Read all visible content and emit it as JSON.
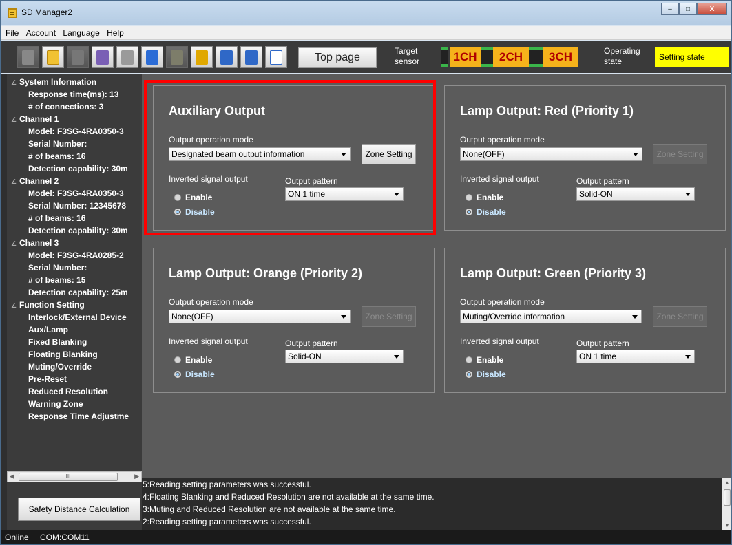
{
  "window": {
    "title": "SD Manager2",
    "minimize": "–",
    "maximize": "□",
    "close": "X"
  },
  "menu": [
    "File",
    "Account",
    "Language",
    "Help"
  ],
  "toolbar": {
    "top_page": "Top page",
    "target_sensor": [
      "Target",
      "sensor"
    ],
    "channels": [
      "1CH",
      "2CH",
      "3CH"
    ],
    "channel_color": "#f5b21b",
    "operating_state_label": [
      "Operating",
      "state"
    ],
    "operating_state": "Setting state",
    "state_color": "#ffff00"
  },
  "tree": [
    {
      "level": 0,
      "text": "System Information"
    },
    {
      "level": 1,
      "text": "Response time(ms): 13"
    },
    {
      "level": 1,
      "text": "# of connections: 3"
    },
    {
      "level": 0,
      "text": "Channel 1"
    },
    {
      "level": 1,
      "text": "Model: F3SG-4RA0350-3"
    },
    {
      "level": 1,
      "text": "Serial Number:"
    },
    {
      "level": 1,
      "text": "# of beams: 16"
    },
    {
      "level": 1,
      "text": "Detection capability: 30m"
    },
    {
      "level": 0,
      "text": "Channel 2"
    },
    {
      "level": 1,
      "text": "Model: F3SG-4RA0350-3"
    },
    {
      "level": 1,
      "text": "Serial Number: 12345678"
    },
    {
      "level": 1,
      "text": "# of beams: 16"
    },
    {
      "level": 1,
      "text": "Detection capability: 30m"
    },
    {
      "level": 0,
      "text": "Channel 3"
    },
    {
      "level": 1,
      "text": "Model: F3SG-4RA0285-2"
    },
    {
      "level": 1,
      "text": "Serial Number:"
    },
    {
      "level": 1,
      "text": "# of beams: 15"
    },
    {
      "level": 1,
      "text": "Detection capability: 25m"
    },
    {
      "level": 0,
      "text": "Function Setting"
    },
    {
      "level": 1,
      "text": "Interlock/External Device"
    },
    {
      "level": 1,
      "text": "Aux/Lamp"
    },
    {
      "level": 1,
      "text": "Fixed Blanking"
    },
    {
      "level": 1,
      "text": "Floating Blanking"
    },
    {
      "level": 1,
      "text": "Muting/Override"
    },
    {
      "level": 1,
      "text": "Pre-Reset"
    },
    {
      "level": 1,
      "text": "Reduced Resolution"
    },
    {
      "level": 1,
      "text": "Warning Zone"
    },
    {
      "level": 1,
      "text": "Response Time Adjustme"
    }
  ],
  "hscroll_thumb": "III",
  "safety_distance_button": "Safety Distance Calculation",
  "labels": {
    "output_operation_mode": "Output operation mode",
    "inverted_signal_output": "Inverted signal output",
    "output_pattern": "Output pattern",
    "enable": "Enable",
    "disable": "Disable",
    "zone_setting": "Zone Setting"
  },
  "panels": {
    "aux": {
      "title": "Auxiliary Output",
      "mode": "Designated beam output information",
      "pattern": "ON 1 time",
      "inverted": "Disable",
      "zone_enabled": true
    },
    "red": {
      "title": "Lamp Output: Red (Priority 1)",
      "mode": "None(OFF)",
      "pattern": "Solid-ON",
      "inverted": "Disable",
      "zone_enabled": false
    },
    "orange": {
      "title": "Lamp Output: Orange (Priority 2)",
      "mode": "None(OFF)",
      "pattern": "Solid-ON",
      "inverted": "Disable",
      "zone_enabled": false
    },
    "green": {
      "title": "Lamp Output: Green (Priority 3)",
      "mode": "Muting/Override information",
      "pattern": "ON 1 time",
      "inverted": "Disable",
      "zone_enabled": false
    }
  },
  "highlight_color": "#ff0000",
  "log": [
    "5:Reading setting parameters was successful.",
    "4:Floating Blanking and Reduced Resolution are not available at the same time.",
    "3:Muting and Reduced Resolution are not available at the same time.",
    "2:Reading setting parameters was successful."
  ],
  "status": {
    "connection": "Online",
    "port": "COM:COM11"
  }
}
